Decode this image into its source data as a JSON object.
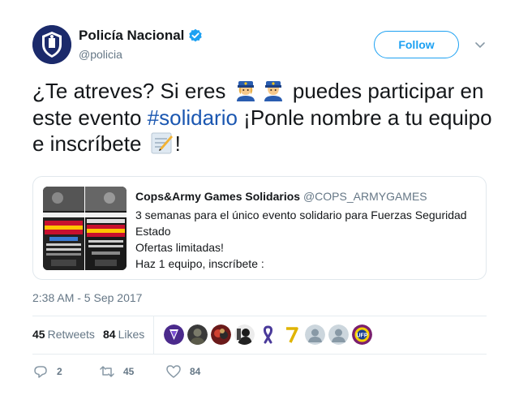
{
  "header": {
    "display_name": "Policía Nacional",
    "handle": "@policia",
    "follow_label": "Follow"
  },
  "tweet": {
    "text_part1": "¿Te atreves? Si eres ",
    "text_part2": " puedes participar en este evento ",
    "hashtag": "#solidario",
    "text_part3": " ¡Ponle nombre a tu equipo e inscríbete ",
    "text_part4": "!",
    "timestamp": "2:38 AM - 5 Sep 2017"
  },
  "card": {
    "name": "Cops&Army Games Solidarios",
    "handle": "@COPS_ARMYGAMES",
    "lines": [
      "3 semanas para el único evento solidario para Fuerzas Seguridad Estado",
      "Ofertas limitadas!",
      "Haz 1 equipo, inscríbete :"
    ]
  },
  "stats": {
    "retweets_count": "45",
    "retweets_label": "Retweets",
    "likes_count": "84",
    "likes_label": "Likes"
  },
  "actions": {
    "reply_count": "2",
    "retweet_count": "45",
    "like_count": "84"
  },
  "colors": {
    "accent": "#1da1f2",
    "hashtag": "#1b57b1",
    "secondary_text": "#657786"
  }
}
